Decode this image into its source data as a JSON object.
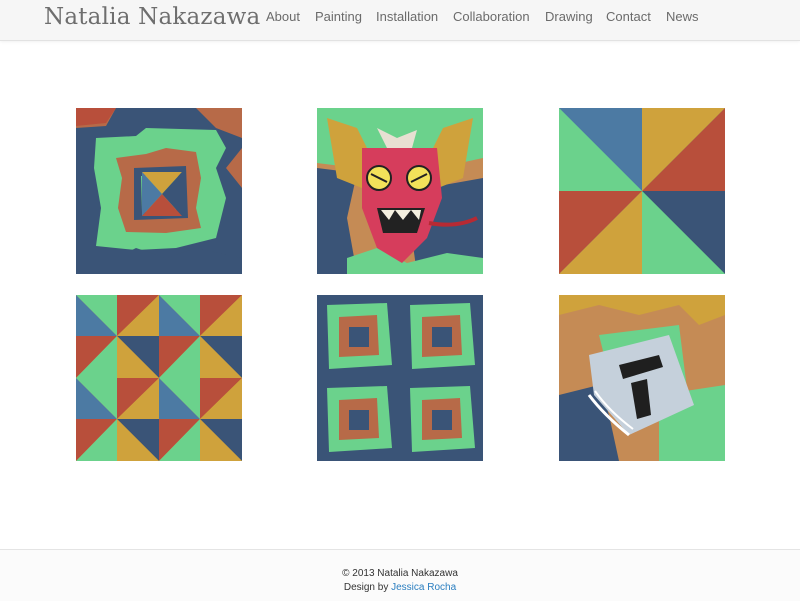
{
  "header": {
    "site_title": "Natalia Nakazawa",
    "nav": {
      "about": "About",
      "painting": "Painting",
      "installation": "Installation",
      "collaboration": "Collaboration",
      "drawing": "Drawing",
      "contact": "Contact",
      "news": "News"
    }
  },
  "footer": {
    "copyright": "© 2013 Natalia Nakazawa",
    "design_prefix": "Design by ",
    "designer": "Jessica Rocha"
  },
  "colors": {
    "brown": "#b76a48",
    "navy": "#3a5477",
    "green": "#6bd28c",
    "mustard": "#cfa23c",
    "rust": "#b84f3b",
    "blue": "#4c7aa3",
    "sand": "#c58b55",
    "link": "#2a7ec0"
  }
}
